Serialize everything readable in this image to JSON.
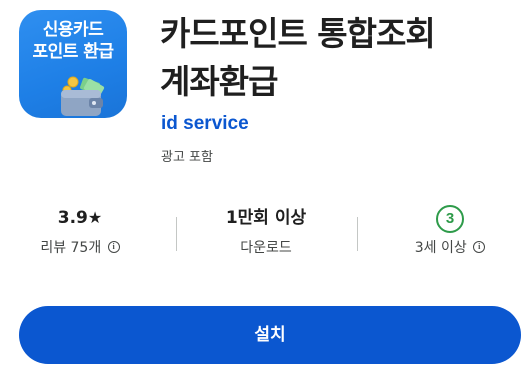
{
  "app": {
    "icon_text_line1": "신용카드",
    "icon_text_line2": "포인트 환급",
    "title_line1": "카드포인트 통합조회",
    "title_line2": "계좌환급",
    "developer": "id service",
    "ad_label": "광고 포함"
  },
  "stats": {
    "rating_value": "3.9",
    "rating_star": "★",
    "rating_label": "리뷰 75개",
    "downloads_value": "1만회 이상",
    "downloads_label": "다운로드",
    "age_badge": "3",
    "age_label": "3세 이상",
    "info_glyph": "i"
  },
  "actions": {
    "install_label": "설치"
  },
  "colors": {
    "accent": "#0b57d0",
    "icon_bg": "#1e7fe6",
    "age_green": "#2e9b4a"
  },
  "icons": [
    "wallet-icon",
    "star-icon",
    "info-icon"
  ]
}
